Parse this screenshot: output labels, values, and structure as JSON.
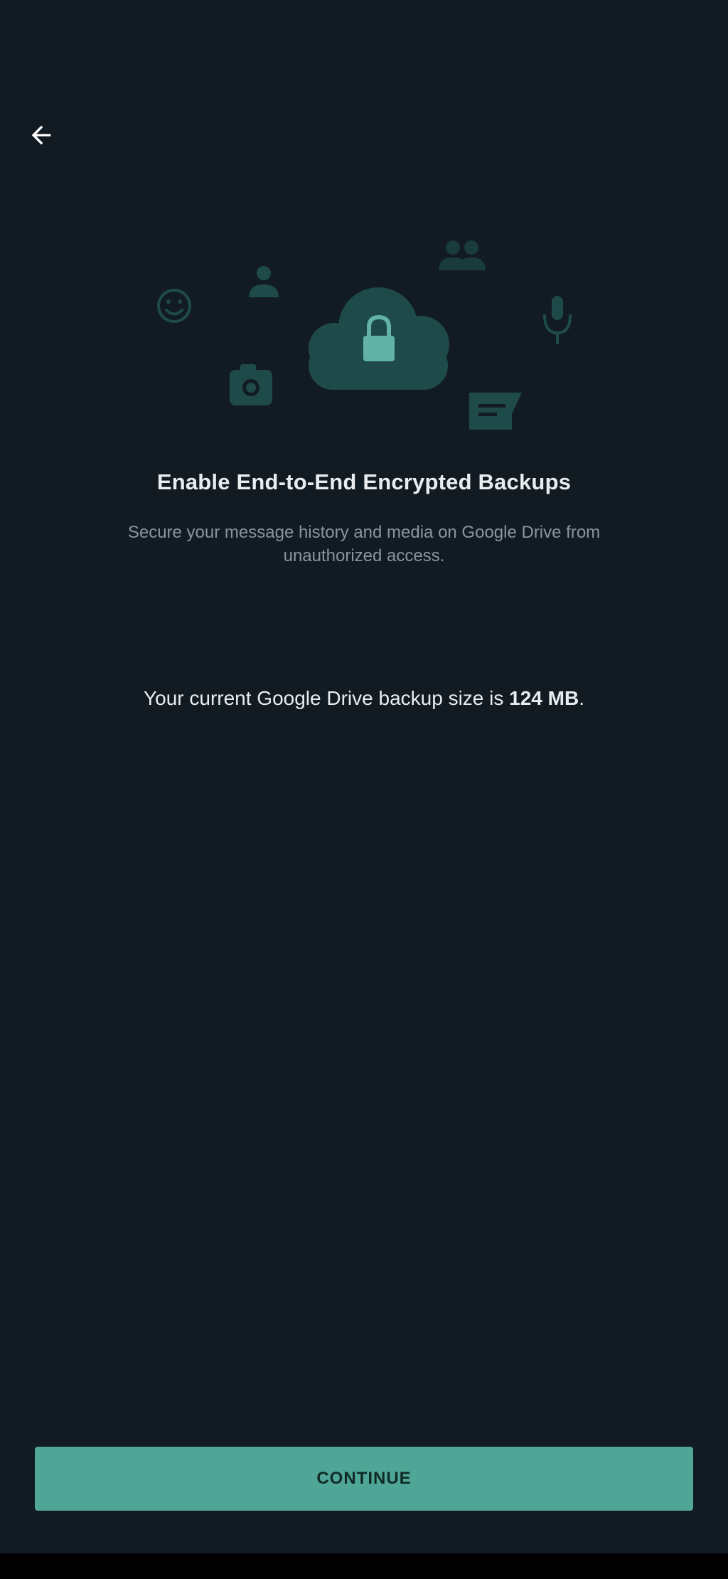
{
  "header": {
    "back_icon": "arrow-left-icon"
  },
  "illustration": {
    "icons": [
      "smiley-icon",
      "person-icon",
      "group-icon",
      "microphone-icon",
      "camera-icon",
      "cloud-lock-icon",
      "chat-icon"
    ],
    "color_dim": "#1f4a4a",
    "color_lock": "#62b3a5"
  },
  "content": {
    "title": "Enable End-to-End Encrypted Backups",
    "subtitle": "Secure your message history and media on Google Drive from unauthorized access.",
    "backup_size_prefix": "Your current Google Drive backup size is ",
    "backup_size_value": "124 MB",
    "backup_size_suffix": "."
  },
  "footer": {
    "continue_label": "CONTINUE"
  },
  "colors": {
    "background": "#121b22",
    "accent": "#4fa596",
    "text_primary": "#e9edef",
    "text_secondary": "#8696a0"
  }
}
